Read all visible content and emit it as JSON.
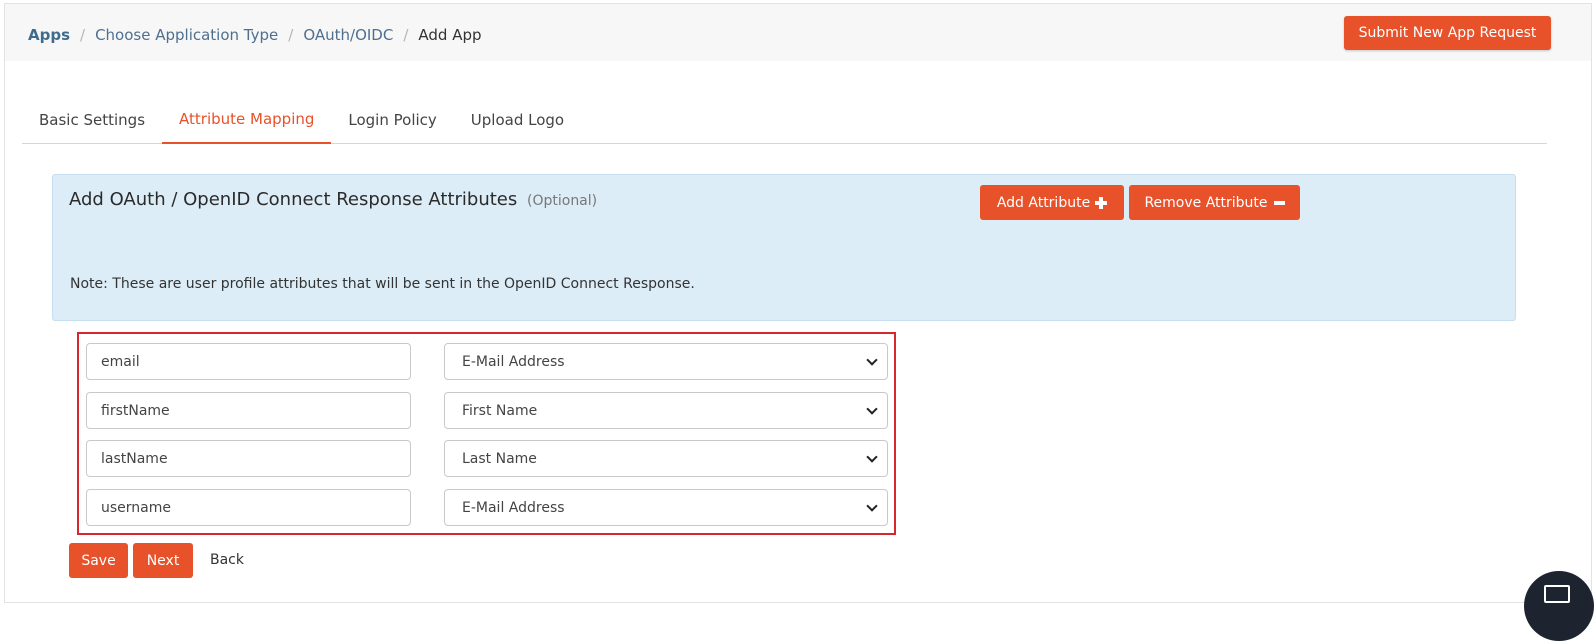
{
  "breadcrumb": {
    "items": [
      "Apps",
      "Choose Application Type",
      "OAuth/OIDC"
    ],
    "current": "Add App",
    "separator": "/"
  },
  "header": {
    "submit_label": "Submit New App Request"
  },
  "tabs": [
    {
      "label": "Basic Settings",
      "active": false
    },
    {
      "label": "Attribute Mapping",
      "active": true
    },
    {
      "label": "Login Policy",
      "active": false
    },
    {
      "label": "Upload Logo",
      "active": false
    }
  ],
  "panel": {
    "title": "Add OAuth / OpenID Connect Response Attributes",
    "optional": "(Optional)",
    "add_label": "Add Attribute",
    "remove_label": "Remove Attribute",
    "note": "Note: These are user profile attributes that will be sent in the OpenID Connect Response."
  },
  "mappings": [
    {
      "attribute": "email",
      "value": "E-Mail Address"
    },
    {
      "attribute": "firstName",
      "value": "First Name"
    },
    {
      "attribute": "lastName",
      "value": "Last Name"
    },
    {
      "attribute": "username",
      "value": "E-Mail Address"
    }
  ],
  "actions": {
    "save_label": "Save",
    "next_label": "Next",
    "back_label": "Back"
  },
  "colors": {
    "accent": "#e8522a",
    "panel_bg": "#dcedf7",
    "highlight_border": "#d6262e",
    "breadcrumb_link": "#4f6f8f"
  },
  "icons": {
    "add": "plus-icon",
    "remove": "minus-icon",
    "select": "chevron-down-icon",
    "chat": "chat-icon"
  }
}
